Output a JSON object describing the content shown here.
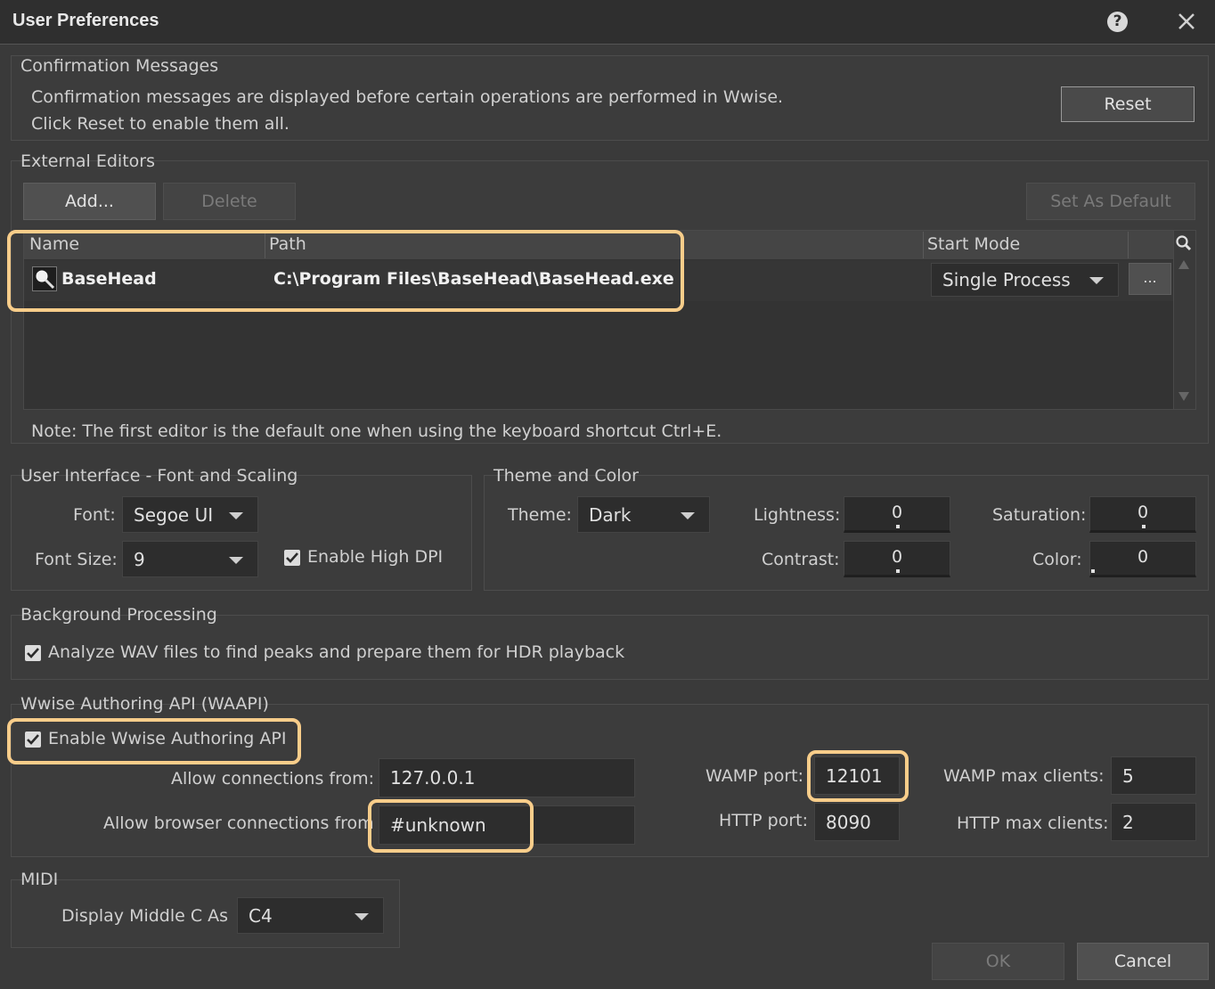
{
  "window": {
    "title": "User Preferences",
    "help_glyph": "?",
    "close_glyph": "✕"
  },
  "confirmation": {
    "group_label": "Confirmation Messages",
    "line1": "Confirmation messages are displayed before certain operations are performed in Wwise.",
    "line2": "Click Reset to enable them all.",
    "reset_label": "Reset"
  },
  "external_editors": {
    "group_label": "External Editors",
    "add_label": "Add...",
    "delete_label": "Delete",
    "set_default_label": "Set As Default",
    "columns": {
      "name": "Name",
      "path": "Path",
      "start_mode": "Start Mode"
    },
    "rows": [
      {
        "name": "BaseHead",
        "path": "C:\\Program Files\\BaseHead\\BaseHead.exe",
        "start_mode": "Single Process",
        "browse_label": "..."
      }
    ],
    "note": "Note: The first editor is the default one when using the keyboard shortcut Ctrl+E."
  },
  "ui_font": {
    "group_label": "User Interface - Font and Scaling",
    "font_label": "Font:",
    "font_value": "Segoe UI",
    "size_label": "Font Size:",
    "size_value": "9",
    "high_dpi_label": "Enable High DPI",
    "high_dpi_checked": true
  },
  "theme": {
    "group_label": "Theme and Color",
    "theme_label": "Theme:",
    "theme_value": "Dark",
    "lightness_label": "Lightness:",
    "lightness_value": "0",
    "saturation_label": "Saturation:",
    "saturation_value": "0",
    "contrast_label": "Contrast:",
    "contrast_value": "0",
    "color_label": "Color:",
    "color_value": "0"
  },
  "background": {
    "group_label": "Background Processing",
    "analyze_label": "Analyze WAV files to find peaks and prepare them for HDR playback",
    "analyze_checked": true
  },
  "waapi": {
    "group_label": "Wwise Authoring API (WAAPI)",
    "enable_label": "Enable Wwise Authoring API",
    "enable_checked": true,
    "allow_from_label": "Allow connections from:",
    "allow_from_value": "127.0.0.1",
    "allow_browser_label": "Allow browser connections from",
    "allow_browser_value": "#unknown",
    "wamp_port_label": "WAMP port:",
    "wamp_port_value": "12101",
    "http_port_label": "HTTP port:",
    "http_port_value": "8090",
    "wamp_max_label": "WAMP max clients:",
    "wamp_max_value": "5",
    "http_max_label": "HTTP max clients:",
    "http_max_value": "2"
  },
  "midi": {
    "group_label": "MIDI",
    "middle_c_label": "Display Middle C As",
    "middle_c_value": "C4"
  },
  "footer": {
    "ok_label": "OK",
    "cancel_label": "Cancel"
  },
  "colors": {
    "highlight": "#f8cd8a",
    "background": "#3a3a3a"
  }
}
